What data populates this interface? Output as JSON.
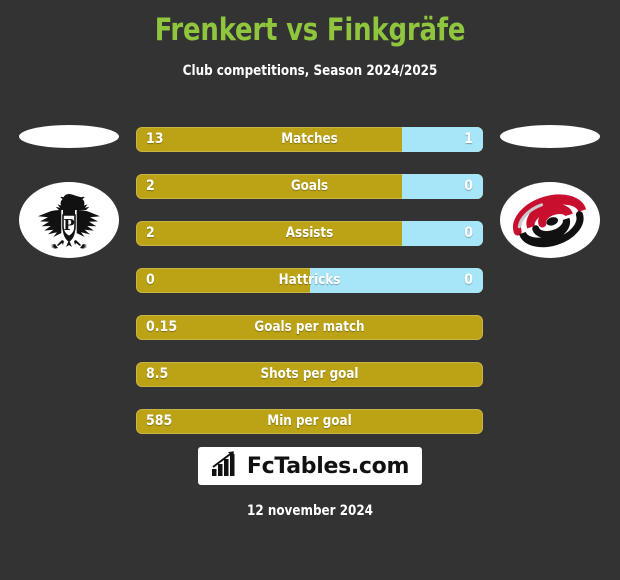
{
  "header": {
    "title": "Frenkert vs Finkgräfe",
    "subtitle": "Club competitions, Season 2024/2025",
    "title_color": "#8FC63D"
  },
  "teams": {
    "left": {
      "logo_name": "preussen-muenster-crest-icon",
      "accent_color": "#BCA316"
    },
    "right": {
      "logo_name": "hurricanes-swirl-crest-icon",
      "accent_color": "#A7E6F9"
    }
  },
  "colors": {
    "background": "#333333",
    "bar_left": "#BCA316",
    "bar_right": "#A7E6F9",
    "text": "#FFFFFF"
  },
  "chart_data": {
    "type": "bar",
    "title": "Frenkert vs Finkgräfe",
    "subtitle": "Club competitions, Season 2024/2025",
    "series": [
      {
        "name": "Frenkert",
        "color": "#BCA316"
      },
      {
        "name": "Finkgräfe",
        "color": "#A7E6F9"
      }
    ],
    "categories": [
      "Matches",
      "Goals",
      "Assists",
      "Hattricks",
      "Goals per match",
      "Shots per goal",
      "Min per goal"
    ],
    "rows": [
      {
        "label": "Matches",
        "left": "13",
        "right": "1",
        "left_pct": 76.6,
        "has_right": true
      },
      {
        "label": "Goals",
        "left": "2",
        "right": "0",
        "left_pct": 76.6,
        "has_right": true
      },
      {
        "label": "Assists",
        "left": "2",
        "right": "0",
        "left_pct": 76.6,
        "has_right": true
      },
      {
        "label": "Hattricks",
        "left": "0",
        "right": "0",
        "left_pct": 50.0,
        "has_right": true
      },
      {
        "label": "Goals per match",
        "left": "0.15",
        "right": "",
        "left_pct": 100,
        "has_right": false
      },
      {
        "label": "Shots per goal",
        "left": "8.5",
        "right": "",
        "left_pct": 100,
        "has_right": false
      },
      {
        "label": "Min per goal",
        "left": "585",
        "right": "",
        "left_pct": 100,
        "has_right": false
      }
    ]
  },
  "footer": {
    "brand": "FcTables.com",
    "brand_icon": "bar-chart-arrow-icon",
    "date": "12 november 2024"
  }
}
